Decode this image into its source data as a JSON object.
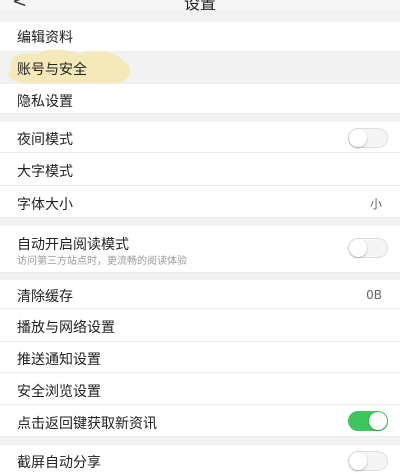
{
  "header": {
    "title": "设置",
    "back_glyph": "<"
  },
  "account": {
    "edit_profile": "编辑资料",
    "account_security": "账号与安全",
    "privacy": "隐私设置"
  },
  "display": {
    "night_mode": {
      "label": "夜间模式",
      "on": false
    },
    "large_text": "大字模式",
    "font_size": {
      "label": "字体大小",
      "value": "小"
    }
  },
  "reading": {
    "auto_reading_mode": {
      "label": "自动开启阅读模式",
      "sub": "访问第三方站点时，更流畅的阅读体验",
      "on": false
    }
  },
  "misc": {
    "clear_cache": {
      "label": "清除缓存",
      "value": "0B"
    },
    "playback_network": "播放与网络设置",
    "push_notifications": "推送通知设置",
    "safe_browsing": "安全浏览设置",
    "back_key_refresh": {
      "label": "点击返回键获取新资讯",
      "on": true
    }
  },
  "share": {
    "screenshot_share": {
      "label": "截屏自动分享",
      "on": false
    }
  },
  "colors": {
    "accent_green": "#3dc55e",
    "highlight": "#f5e6a6"
  }
}
